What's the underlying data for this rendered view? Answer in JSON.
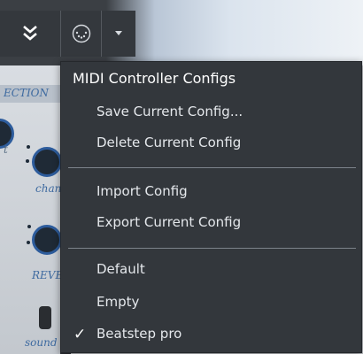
{
  "toolbar": {
    "collapse_icon": "chevrons-down-icon",
    "midi_icon": "midi-connector-icon",
    "dropdown_icon": "caret-down-icon"
  },
  "panel": {
    "section_label": "ECTION",
    "label_t": "t",
    "label_chan": "chan",
    "label_reve": "REVE",
    "label_sound": "sound r"
  },
  "menu": {
    "title": "MIDI Controller Configs",
    "items": [
      {
        "label": "Save Current Config...",
        "checked": false
      },
      {
        "label": "Delete Current Config",
        "checked": false
      },
      {
        "label": "Import Config",
        "checked": false
      },
      {
        "label": "Export Current Config",
        "checked": false
      },
      {
        "label": "Default",
        "checked": false
      },
      {
        "label": "Empty",
        "checked": false
      },
      {
        "label": "Beatstep pro",
        "checked": true
      }
    ],
    "check_glyph": "✓"
  },
  "colors": {
    "menu_bg": "#33373c",
    "menu_text": "#e5e8ec",
    "accent_blue": "#2d5c9c"
  }
}
